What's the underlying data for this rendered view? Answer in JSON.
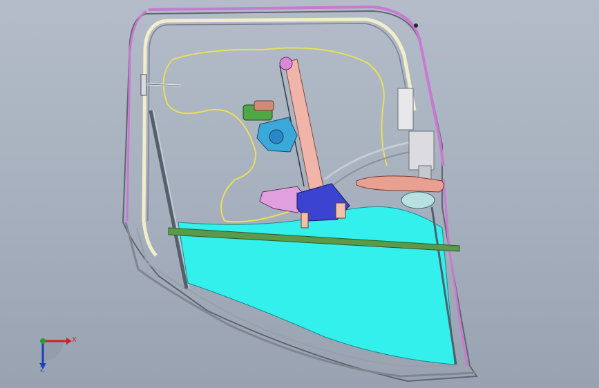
{
  "viewport": {
    "background_top": "#b3bcc8",
    "background_bottom": "#98a2b1"
  },
  "triad": {
    "x_label": "X",
    "z_label": "Z",
    "x_color": "#d12020",
    "y_color": "#22a02a",
    "z_color": "#1f3fbf"
  },
  "colors": {
    "outer_seal": "#c87ad0",
    "inner_seal": "#f2eecb",
    "glass": "#33f0ec",
    "guide_rail": "#5a9a4a",
    "rail": "#f0b4a8",
    "motor": "#3aa8d8",
    "cable": "#e8e05a",
    "carrier": "#3a44d0",
    "handle": "#e8a090"
  }
}
